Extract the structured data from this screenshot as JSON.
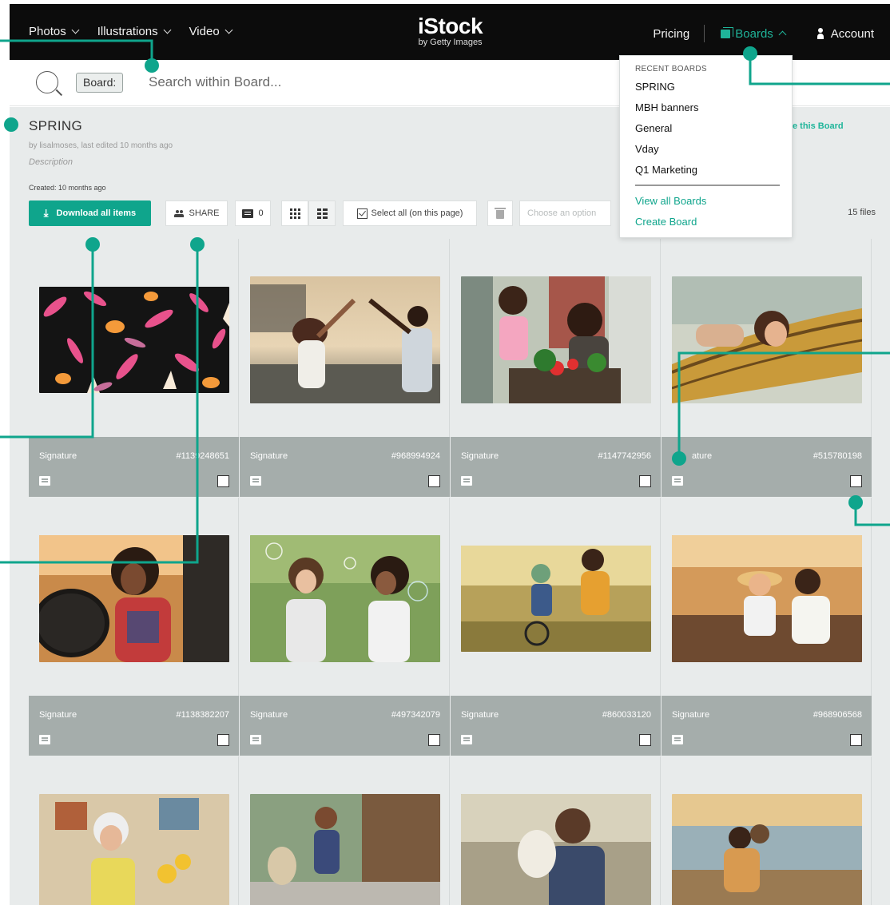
{
  "nav": {
    "photos": "Photos",
    "illustrations": "Illustrations",
    "video": "Video",
    "logo_main": "iStock",
    "logo_sub": "by Getty Images",
    "pricing": "Pricing",
    "boards": "Boards",
    "account": "Account"
  },
  "search": {
    "chip": "Board:",
    "placeholder": "Search within Board..."
  },
  "board": {
    "title": "SPRING",
    "meta": "by lisalmoses, last edited 10 months ago",
    "description": "Description",
    "created": "Created: 10 months ago",
    "share_link": "e this Board"
  },
  "toolbar": {
    "download": "Download all items",
    "share": "SHARE",
    "comments": "0",
    "select_all": "Select all (on this page)",
    "choose_option": "Choose an option",
    "file_count": "15 files"
  },
  "dropdown": {
    "header": "RECENT BOARDS",
    "items": [
      "SPRING",
      "MBH banners",
      "General",
      "Vday",
      "Q1 Marketing"
    ],
    "view_all": "View all Boards",
    "create": "Create Board"
  },
  "cards": [
    {
      "sig": "Signature",
      "id": "#1139248651"
    },
    {
      "sig": "Signature",
      "id": "#968994924"
    },
    {
      "sig": "Signature",
      "id": "#1147742956"
    },
    {
      "sig": "ature",
      "id": "#515780198"
    },
    {
      "sig": "Signature",
      "id": "#1138382207"
    },
    {
      "sig": "Signature",
      "id": "#497342079"
    },
    {
      "sig": "Signature",
      "id": "#860033120"
    },
    {
      "sig": "Signature",
      "id": "#968906568"
    }
  ],
  "colors": {
    "accent": "#0fa58c",
    "nav_bg": "#0c0c0c",
    "footer_bg": "#a5adab",
    "page_bg": "#e8ebeb"
  }
}
